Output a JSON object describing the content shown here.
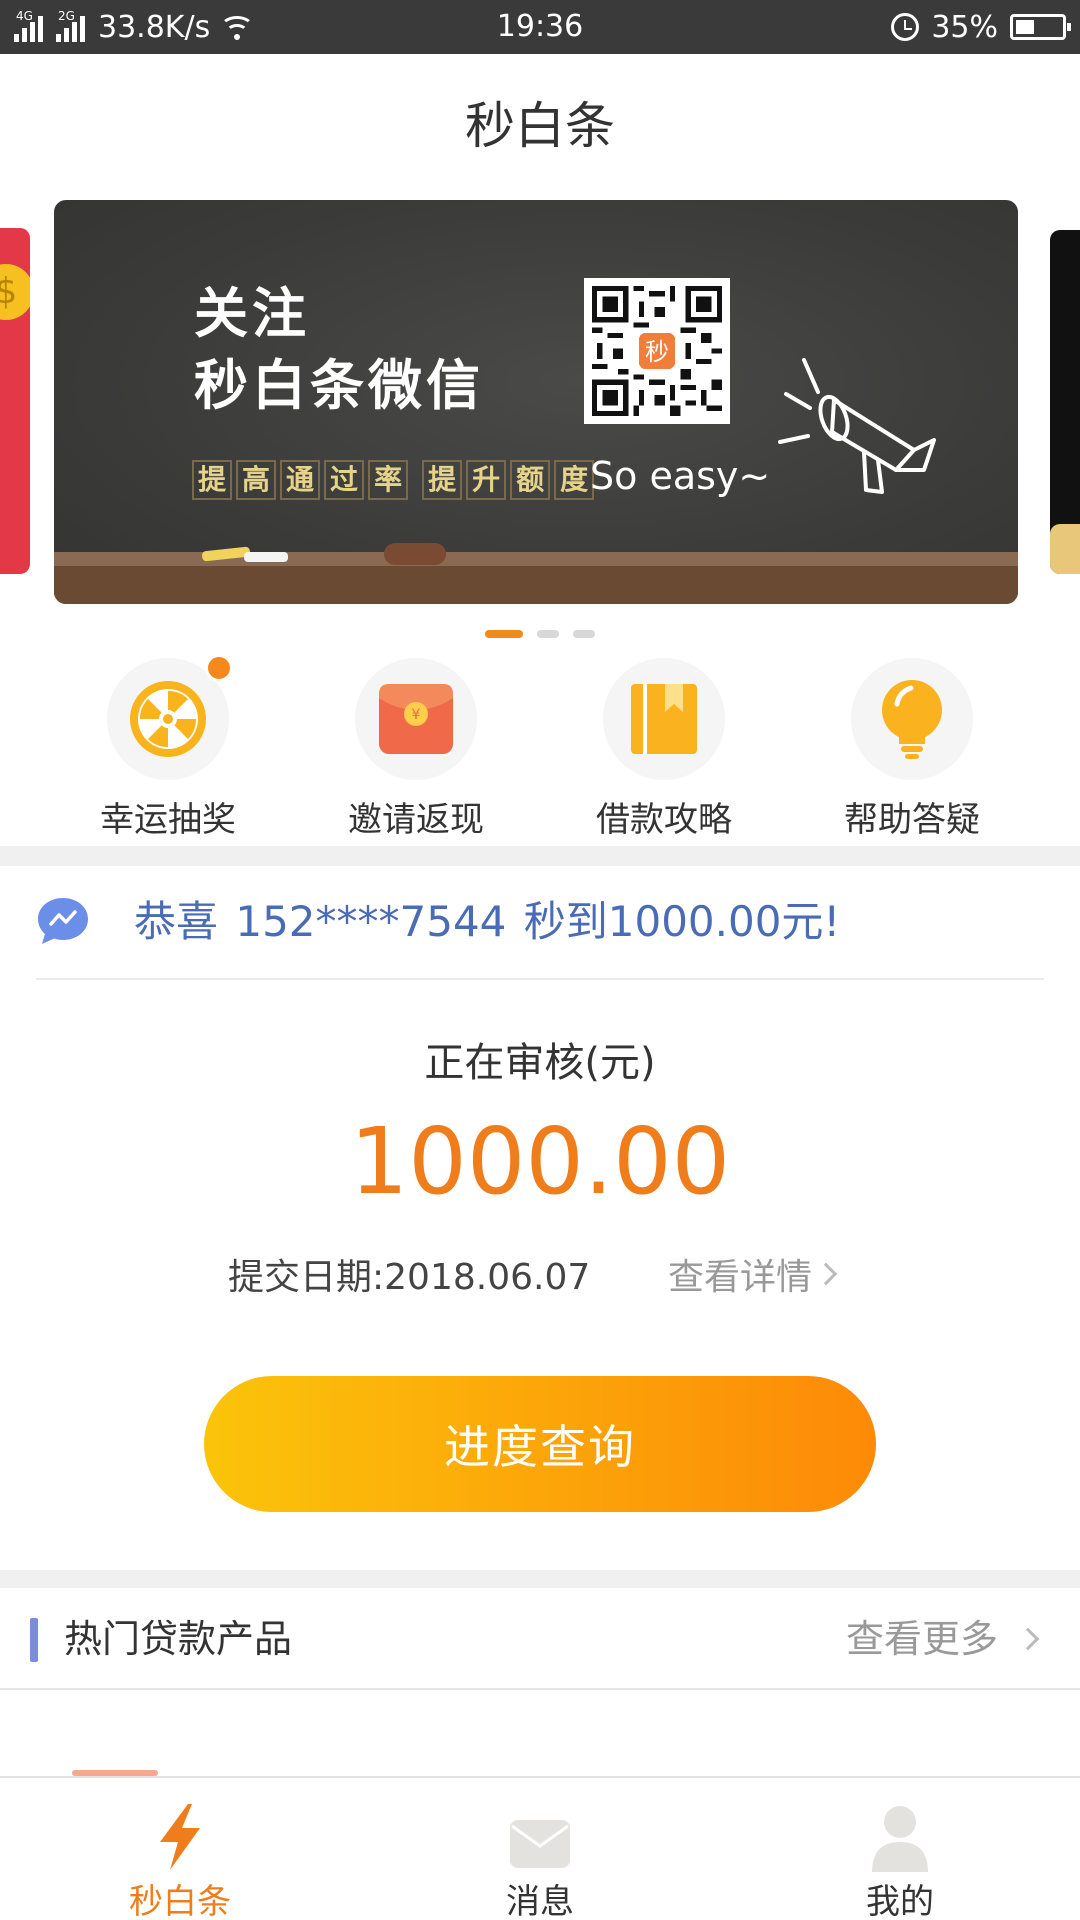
{
  "status_bar": {
    "network1": "4G",
    "network2": "2G",
    "speed": "33.8K/s",
    "time": "19:36",
    "battery": "35%"
  },
  "header": {
    "title": "秒白条"
  },
  "banner": {
    "title_line1": "关注",
    "title_line2": "秒白条微信",
    "tags": [
      "提",
      "高",
      "通",
      "过",
      "率",
      "提",
      "升",
      "额",
      "度"
    ],
    "slogan": "So easy~",
    "qr_logo": "秒",
    "carousel_index": 1,
    "carousel_total": 3
  },
  "menu": {
    "items": [
      {
        "label": "幸运抽奖",
        "icon": "wheel-icon"
      },
      {
        "label": "邀请返现",
        "icon": "red-envelope-icon"
      },
      {
        "label": "借款攻略",
        "icon": "book-icon"
      },
      {
        "label": "帮助答疑",
        "icon": "lightbulb-icon"
      }
    ]
  },
  "notice": {
    "text": "恭喜 152****7544 秒到1000.00元!"
  },
  "review": {
    "title": "正在审核(元)",
    "amount": "1000.00",
    "date_label": "提交日期:2018.06.07",
    "detail_link": "查看详情"
  },
  "cta": {
    "label": "进度查询"
  },
  "hot": {
    "title": "热门贷款产品",
    "more": "查看更多"
  },
  "tabs": [
    {
      "label": "秒白条",
      "icon": "lightning-icon",
      "active": true
    },
    {
      "label": "消息",
      "icon": "message-icon",
      "active": false
    },
    {
      "label": "我的",
      "icon": "user-icon",
      "active": false
    }
  ],
  "colors": {
    "accent": "#f07d1b",
    "notice": "#4a6bb5",
    "cta_start": "#fbc40a",
    "cta_end": "#fd8a07"
  }
}
